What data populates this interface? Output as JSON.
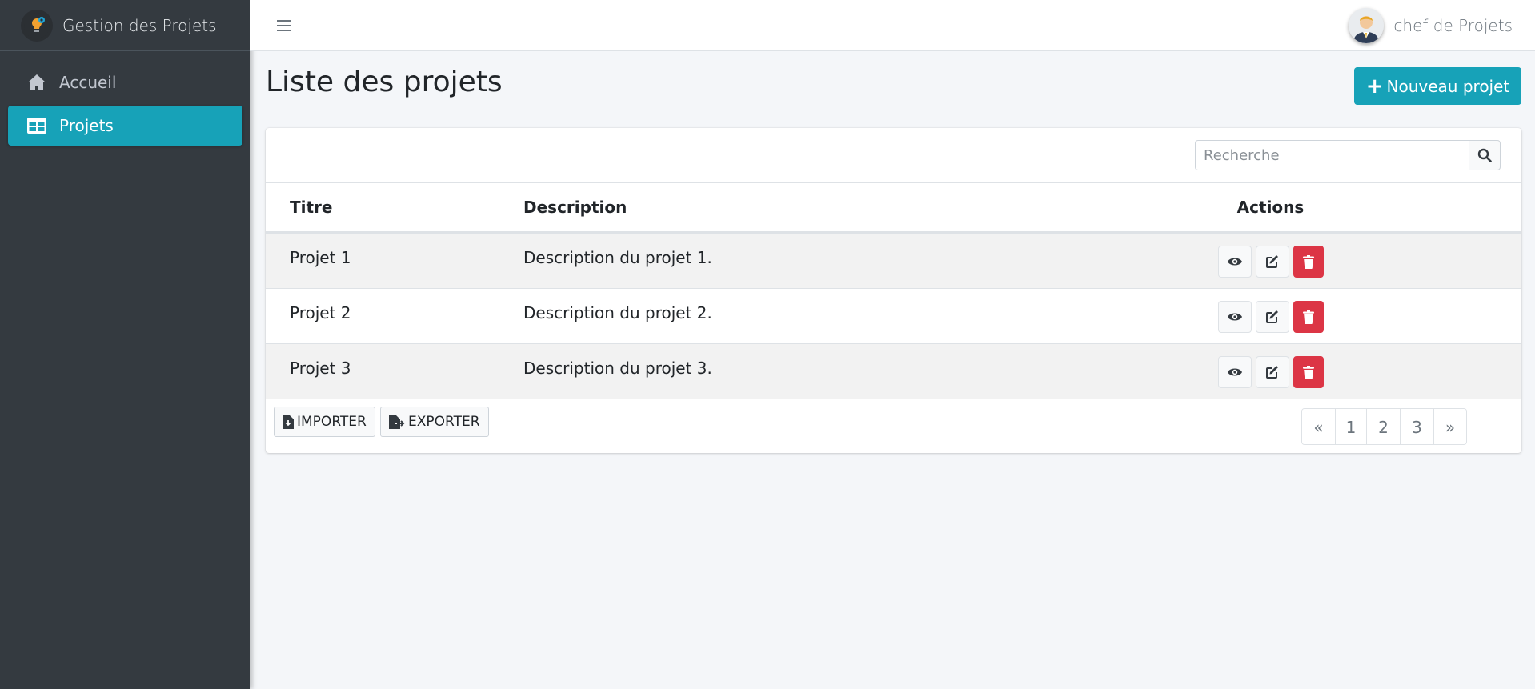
{
  "app": {
    "brand": "Gestion des Projets"
  },
  "sidebar": {
    "items": [
      {
        "label": "Accueil",
        "icon": "home-icon",
        "active": false
      },
      {
        "label": "Projets",
        "icon": "table-icon",
        "active": true
      }
    ]
  },
  "topbar": {
    "user_name": "chef de Projets"
  },
  "page": {
    "title": "Liste des projets",
    "new_button": "Nouveau projet"
  },
  "search": {
    "placeholder": "Recherche",
    "value": ""
  },
  "table": {
    "headers": [
      "Titre",
      "Description",
      "Actions"
    ],
    "rows": [
      {
        "title": "Projet 1",
        "description": "Description du projet 1."
      },
      {
        "title": "Projet 2",
        "description": "Description du projet 2."
      },
      {
        "title": "Projet 3",
        "description": "Description du projet 3."
      }
    ]
  },
  "footer": {
    "import_label": "IMPORTER",
    "export_label": "EXPORTER"
  },
  "pagination": {
    "prev": "«",
    "pages": [
      "1",
      "2",
      "3"
    ],
    "next": "»"
  },
  "colors": {
    "accent": "#17a2b8",
    "sidebar": "#343a40",
    "danger": "#dc3545"
  }
}
